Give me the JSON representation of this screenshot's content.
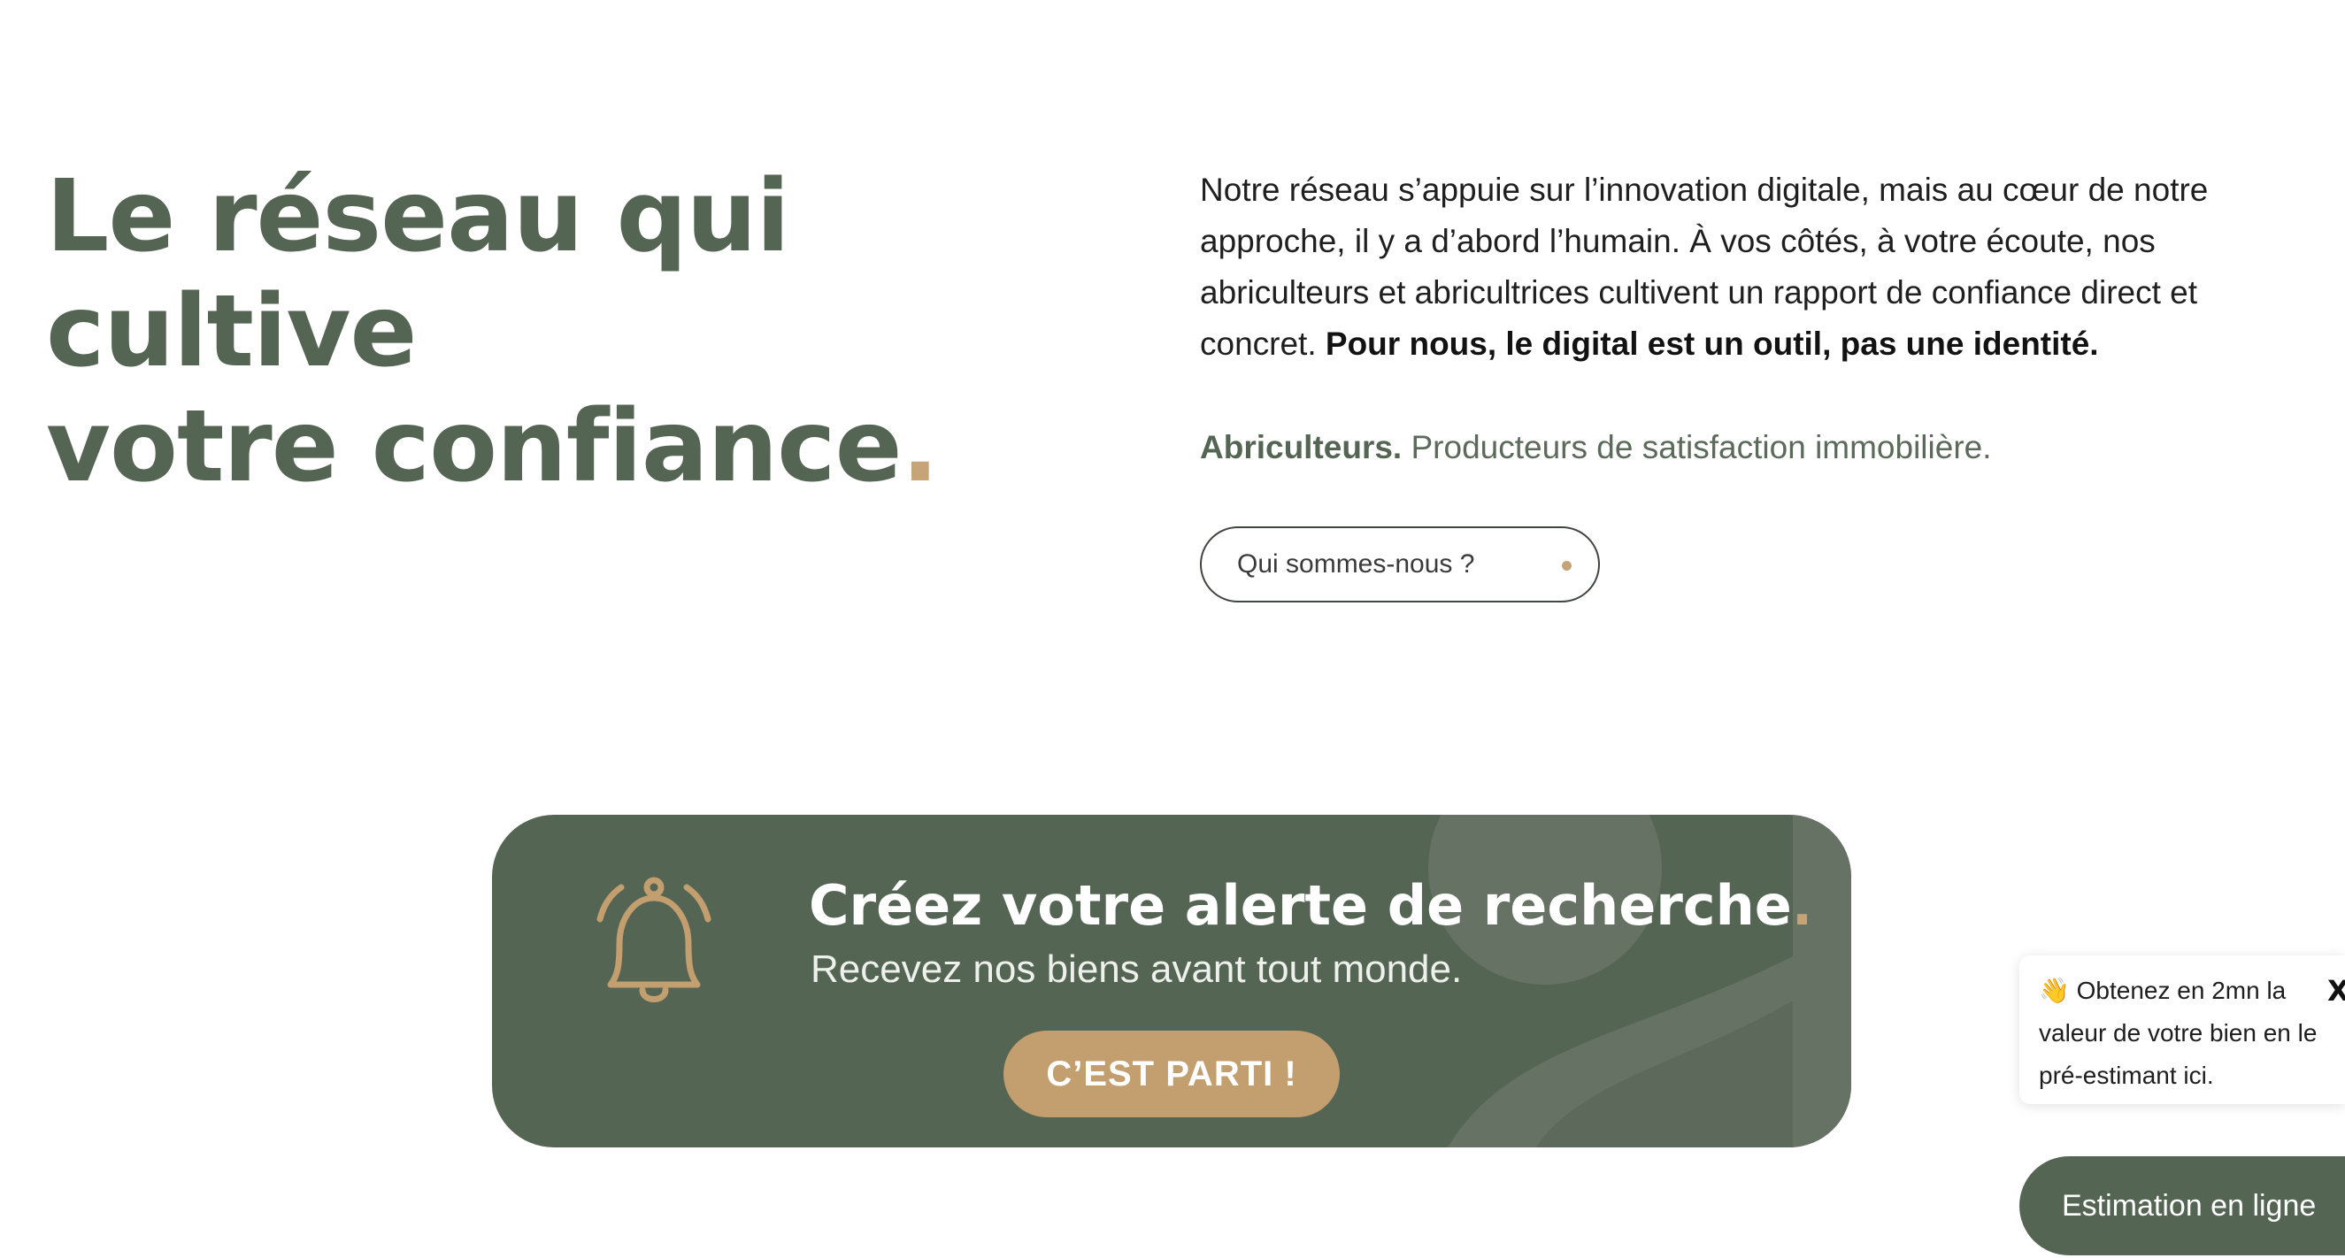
{
  "hero": {
    "title_line1": "Le réseau qui cultive",
    "title_line2": "votre confiance",
    "title_dot": ".",
    "intro_text": "Notre réseau s’appuie sur l’innovation digitale, mais au cœur de notre approche, il y a d’abord l’humain. À vos côtés, à votre écoute, nos abriculteurs et abricultrices cultivent un rapport de confiance direct et concret. ",
    "intro_bold": "Pour nous, le digital est un outil, pas une identité.",
    "tagline_bold": "Abriculteurs.",
    "tagline_text": " Producteurs de satisfaction immobilière.",
    "about_button": "Qui sommes-nous ?"
  },
  "alert_banner": {
    "icon": "bell-icon",
    "title": "Créez votre alerte de recherche",
    "title_dot": ".",
    "subtitle": "Recevez nos biens avant tout monde.",
    "cta": "C’EST PARTI !"
  },
  "estimate_popup": {
    "emoji": "👋",
    "text": "Obtenez en 2mn la valeur de votre bien en le pré-estimant ici.",
    "line1": "Obtenez en 2mn la",
    "line2": "valeur de votre bien en le",
    "line3": "pré-estimant ici.",
    "close_label": "X"
  },
  "estimate_button": {
    "label": "Estimation en ligne"
  },
  "colors": {
    "brand_green": "#556554",
    "accent_gold": "#c6a477",
    "cta_gold": "#c39e6f",
    "background": "#ffffff"
  }
}
